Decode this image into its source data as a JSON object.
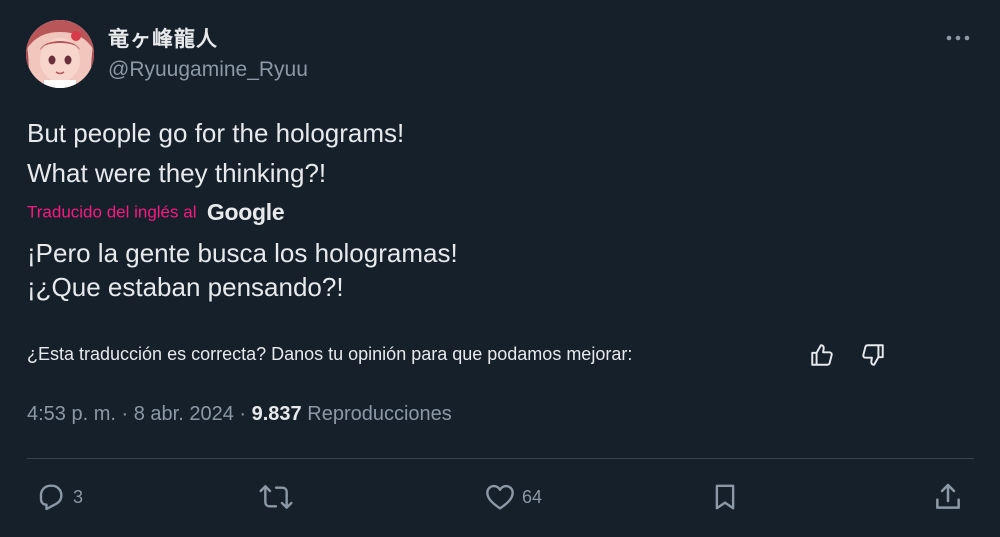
{
  "author": {
    "display_name": "竜ヶ峰龍人",
    "handle": "@Ryuugamine_Ryuu",
    "avatar_icon": "anime-girl-avatar"
  },
  "tweet": {
    "original_lines": [
      "But people go for the holograms!",
      "What were they thinking?!"
    ],
    "translated_by": "Traducido del inglés al",
    "translator_brand": "Google",
    "translated_lines": [
      "¡Pero la gente busca los hologramas!",
      "¡¿Que estaban pensando?!"
    ],
    "feedback_prompt": "¿Esta traducción es correcta? Danos tu opinión para que podamos mejorar:",
    "time": "4:53 p. m.",
    "separator": "·",
    "date": "8 abr. 2024",
    "views_count": "9.837",
    "views_label": "Reproducciones"
  },
  "actions": {
    "reply_count": "3",
    "retweet_count": "",
    "like_count": "64"
  },
  "colors": {
    "background": "#15202b",
    "text": "#e7e9ea",
    "secondary": "#8b98a5",
    "accent_pink": "#f91880",
    "divider": "#38444d"
  },
  "icons": {
    "more": "more-horizontal-icon",
    "thumb_up": "thumbs-up-icon",
    "thumb_down": "thumbs-down-icon",
    "reply": "reply-icon",
    "retweet": "retweet-icon",
    "like": "heart-icon",
    "bookmark": "bookmark-icon",
    "share": "share-icon"
  }
}
